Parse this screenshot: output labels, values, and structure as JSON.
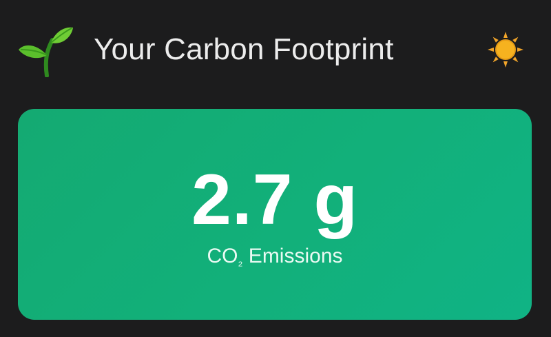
{
  "header": {
    "title": "Your Carbon Footprint",
    "leading_icon": "sprout-icon",
    "trailing_icon": "sun-icon"
  },
  "emissions_card": {
    "value": "2.7 g",
    "label_prefix": "CO",
    "label_subscript": "₂",
    "label_suffix": " Emissions"
  },
  "colors": {
    "background": "#1c1c1d",
    "card": "#12b07a",
    "title_text": "#ececec"
  }
}
